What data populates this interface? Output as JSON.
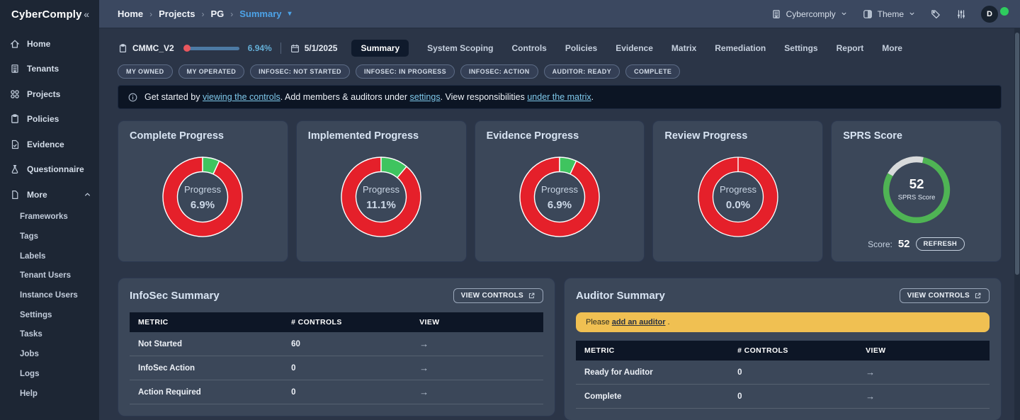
{
  "app": {
    "name": "CyberComply",
    "collapse_icon": "«"
  },
  "topbar": {
    "breadcrumb": [
      "Home",
      "Projects",
      "PG"
    ],
    "breadcrumb_current": "Summary",
    "tenant_label": "Cybercomply",
    "theme_label": "Theme",
    "avatar_initial": "D"
  },
  "sidebar": {
    "items": [
      {
        "label": "Home",
        "icon": "home"
      },
      {
        "label": "Tenants",
        "icon": "building"
      },
      {
        "label": "Projects",
        "icon": "grid"
      },
      {
        "label": "Policies",
        "icon": "clipboard"
      },
      {
        "label": "Evidence",
        "icon": "doc-check"
      },
      {
        "label": "Questionnaire",
        "icon": "flask"
      },
      {
        "label": "More",
        "icon": "page",
        "expanded": true
      }
    ],
    "more_items": [
      "Frameworks",
      "Tags",
      "Labels",
      "Tenant Users",
      "Instance Users",
      "Settings",
      "Tasks",
      "Jobs",
      "Logs",
      "Help"
    ]
  },
  "project_bar": {
    "name": "CMMC_V2",
    "progress": "6.94%",
    "date": "5/1/2025",
    "tabs": [
      "Summary",
      "System Scoping",
      "Controls",
      "Policies",
      "Evidence",
      "Matrix",
      "Remediation",
      "Settings",
      "Report",
      "More"
    ],
    "active_tab": "Summary"
  },
  "filters": [
    "MY OWNED",
    "MY OPERATED",
    "INFOSEC: NOT STARTED",
    "INFOSEC: IN PROGRESS",
    "INFOSEC: ACTION",
    "AUDITOR: READY",
    "COMPLETE"
  ],
  "banner": {
    "segments": [
      {
        "text": "Get started by ",
        "link": false
      },
      {
        "text": "viewing the controls",
        "link": true
      },
      {
        "text": ". Add members & auditors under ",
        "link": false
      },
      {
        "text": "settings",
        "link": true
      },
      {
        "text": ". View responsibilities ",
        "link": false
      },
      {
        "text": "under the matrix",
        "link": true
      },
      {
        "text": ".",
        "link": false
      }
    ]
  },
  "chart_data": [
    {
      "type": "pie",
      "title": "Complete Progress",
      "center_label": "Progress",
      "center_value": "6.9%",
      "labels": [
        "complete",
        "remaining"
      ],
      "values": [
        6.9,
        93.1
      ],
      "colors": [
        "#3fc45f",
        "#e5202a"
      ]
    },
    {
      "type": "pie",
      "title": "Implemented Progress",
      "center_label": "Progress",
      "center_value": "11.1%",
      "labels": [
        "implemented",
        "remaining"
      ],
      "values": [
        11.1,
        88.9
      ],
      "colors": [
        "#3fc45f",
        "#e5202a"
      ]
    },
    {
      "type": "pie",
      "title": "Evidence Progress",
      "center_label": "Progress",
      "center_value": "6.9%",
      "labels": [
        "evidence",
        "remaining"
      ],
      "values": [
        6.9,
        93.1
      ],
      "colors": [
        "#3fc45f",
        "#e5202a"
      ]
    },
    {
      "type": "pie",
      "title": "Review Progress",
      "center_label": "Progress",
      "center_value": "0.0%",
      "labels": [
        "reviewed",
        "remaining"
      ],
      "values": [
        0.0,
        100.0
      ],
      "colors": [
        "#3fc45f",
        "#e5202a"
      ]
    },
    {
      "type": "pie",
      "title": "SPRS Score",
      "center_value": "52",
      "center_label": "SPRS Score",
      "labels": [
        "score",
        "remaining"
      ],
      "values": [
        82,
        18
      ],
      "colors": [
        "#4fb454",
        "#d8dadb"
      ]
    }
  ],
  "sprs": {
    "score_label": "Score:",
    "score_value": "52",
    "refresh_label": "REFRESH"
  },
  "infosec_summary": {
    "title": "InfoSec Summary",
    "view_controls_label": "VIEW CONTROLS",
    "table": {
      "headers": [
        "METRIC",
        "# CONTROLS",
        "VIEW"
      ],
      "rows": [
        {
          "metric": "Not Started",
          "controls": "60"
        },
        {
          "metric": "InfoSec Action",
          "controls": "0"
        },
        {
          "metric": "Action Required",
          "controls": "0"
        }
      ]
    }
  },
  "auditor_summary": {
    "title": "Auditor Summary",
    "view_controls_label": "VIEW CONTROLS",
    "notice": {
      "prefix": "Please ",
      "link": "add an auditor",
      "suffix": " ."
    },
    "table": {
      "headers": [
        "METRIC",
        "# CONTROLS",
        "VIEW"
      ],
      "rows": [
        {
          "metric": "Ready for Auditor",
          "controls": "0"
        },
        {
          "metric": "Complete",
          "controls": "0"
        }
      ]
    }
  },
  "colors": {
    "accent_blue": "#4da3e8",
    "donut_red": "#e5202a",
    "donut_green": "#3fc45f",
    "sprs_green": "#4fb454",
    "sprs_gray": "#d8dadb",
    "warning_yellow": "#f0c052",
    "status_green": "#2ecc5e"
  }
}
